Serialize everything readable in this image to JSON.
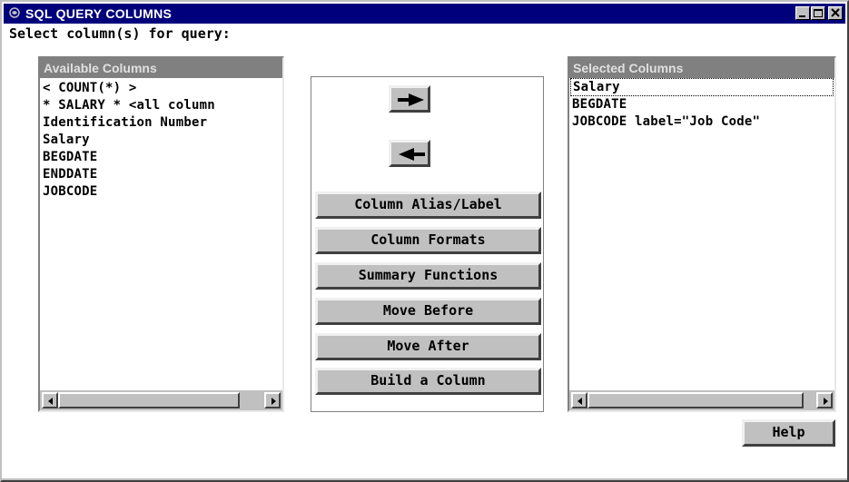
{
  "window": {
    "title": "SQL QUERY COLUMNS",
    "app_icon": "sas-icon",
    "controls": [
      "minimize-icon",
      "maximize-icon",
      "close-icon"
    ]
  },
  "prompt": "Select column(s) for query:",
  "available": {
    "header": "Available Columns",
    "items": [
      "< COUNT(*) >",
      "* SALARY * <all column",
      "Identification Number",
      "Salary",
      "BEGDATE",
      "ENDDATE",
      "JOBCODE"
    ]
  },
  "selected": {
    "header": "Selected Columns",
    "items": [
      "Salary",
      "BEGDATE",
      "JOBCODE label=\"Job Code\""
    ]
  },
  "actions": {
    "add_icon": "right-arrow-icon",
    "remove_icon": "left-arrow-icon",
    "buttons": [
      "Column Alias/Label",
      "Column Formats",
      "Summary Functions",
      "Move Before",
      "Move After",
      "Build a Column"
    ]
  },
  "help_label": "Help"
}
